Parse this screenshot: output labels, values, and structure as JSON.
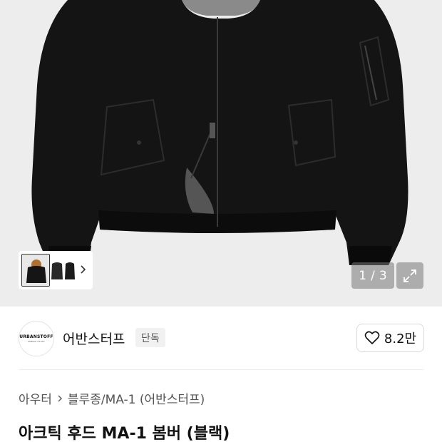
{
  "gallery": {
    "counter_current": "1",
    "counter_sep": "/",
    "counter_total": "3",
    "thumbnail_count": 3
  },
  "brand": {
    "logo_text": "URBANSTOFF",
    "logo_subtext": "URBAN STUFF",
    "name": "어반스터프",
    "badge": "단독"
  },
  "like": {
    "count": "8.2만"
  },
  "breadcrumb": {
    "items": [
      "아우터",
      "블루종/MA-1 (어반스터프)"
    ]
  },
  "product": {
    "title": "아크틱 후드 MA-1 봄버 (블랙)"
  },
  "colors": {
    "hero_bg": "#ededed",
    "jacket": "#141414",
    "fur": "#8a8a8a",
    "overlay": "rgba(120,120,120,0.55)"
  }
}
